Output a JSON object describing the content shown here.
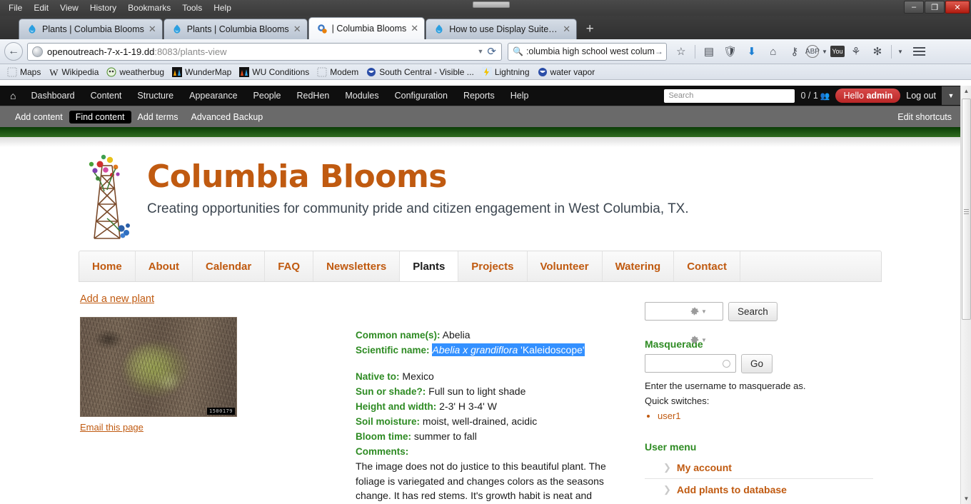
{
  "browser": {
    "menu": [
      "File",
      "Edit",
      "View",
      "History",
      "Bookmarks",
      "Tools",
      "Help"
    ],
    "window_controls": {
      "minimize": "–",
      "maximize": "❐",
      "close": "✕"
    },
    "tabs": [
      {
        "title": "Plants | Columbia Blooms",
        "favicon": "drupal-droplet-icon",
        "active": false
      },
      {
        "title": "Plants | Columbia Blooms",
        "favicon": "drupal-droplet-icon",
        "active": false
      },
      {
        "title": "| Columbia Blooms",
        "favicon": "gear-icon",
        "active": true
      },
      {
        "title": "How to use Display Suite t...",
        "favicon": "drupal-droplet-icon",
        "active": false
      }
    ],
    "new_tab_label": "+",
    "url": {
      "host": "openoutreach-7-x-1-19.dd",
      "rest": ":8083/plants-view"
    },
    "search": {
      "value": ":olumbia high school west colum",
      "placeholder": "Search"
    },
    "toolbar_icons": [
      "star-icon",
      "reader-icon",
      "shield-icon",
      "download-arrow-icon",
      "home-icon",
      "key-icon",
      "abp-icon",
      "youtube-icon",
      "runner-icon",
      "spider-icon",
      "chevron-down-icon",
      "hamburger-menu-icon"
    ],
    "bookmarks": [
      {
        "label": "Maps",
        "icon": "placeholder-icon"
      },
      {
        "label": "Wikipedia",
        "icon": "wikipedia-w-icon"
      },
      {
        "label": "weatherbug",
        "icon": "weatherbug-icon"
      },
      {
        "label": "WunderMap",
        "icon": "wunderground-icon"
      },
      {
        "label": "WU Conditions",
        "icon": "wunderground-icon"
      },
      {
        "label": "Modem",
        "icon": "placeholder-icon"
      },
      {
        "label": "South Central - Visible ...",
        "icon": "noaa-icon"
      },
      {
        "label": "Lightning",
        "icon": "lightning-icon"
      },
      {
        "label": "water vapor",
        "icon": "noaa-icon"
      }
    ]
  },
  "admin_toolbar": {
    "home_icon": "home-icon",
    "items": [
      "Dashboard",
      "Content",
      "Structure",
      "Appearance",
      "People",
      "RedHen",
      "Modules",
      "Configuration",
      "Reports",
      "Help"
    ],
    "search_placeholder": "Search",
    "user_count": "0 / 1",
    "greeting_prefix": "Hello",
    "greeting_user": "admin",
    "logout": "Log out",
    "dropdown_icon": "chevron-down-icon"
  },
  "shortcuts": {
    "items": [
      {
        "label": "Add content",
        "selected": false
      },
      {
        "label": "Find content",
        "selected": true
      },
      {
        "label": "Add terms",
        "selected": false
      },
      {
        "label": "Advanced Backup",
        "selected": false
      }
    ],
    "edit_label": "Edit shortcuts"
  },
  "site": {
    "name": "Columbia Blooms",
    "slogan": "Creating opportunities for community pride and citizen engagement in West Columbia, TX.",
    "logo_icon": "oil-derrick-with-flowers-logo",
    "nav": [
      {
        "label": "Home",
        "active": false
      },
      {
        "label": "About",
        "active": false
      },
      {
        "label": "Calendar",
        "active": false
      },
      {
        "label": "FAQ",
        "active": false
      },
      {
        "label": "Newsletters",
        "active": false
      },
      {
        "label": "Plants",
        "active": true
      },
      {
        "label": "Projects",
        "active": false
      },
      {
        "label": "Volunteer",
        "active": false
      },
      {
        "label": "Watering",
        "active": false
      },
      {
        "label": "Contact",
        "active": false
      }
    ]
  },
  "content": {
    "add_plant_link": "Add a new plant",
    "email_link": "Email this page",
    "image_stamp": "1500179",
    "image_alt": "abelia-shrub-photo",
    "fields": [
      {
        "label": "Common name(s):",
        "value": "Abelia"
      }
    ],
    "scientific": {
      "label": "Scientific name:",
      "italic_part": "Abelia x grandiflora",
      "cultivar_part": "'Kaleidoscope'",
      "selected": true
    },
    "details": [
      {
        "label": "Native to:",
        "value": "Mexico"
      },
      {
        "label": "Sun or shade?:",
        "value": "Full sun to light shade"
      },
      {
        "label": "Height and width:",
        "value": "2-3' H 3-4' W"
      },
      {
        "label": "Soil moisture:",
        "value": "moist, well-drained, acidic"
      },
      {
        "label": "Bloom time:",
        "value": "summer to fall"
      }
    ],
    "comments_label": "Comments:",
    "comments_lines": [
      "The image does not do justice to this beautiful plant. The",
      "foliage is variegated and changes colors as the seasons",
      "change. It has red stems. It's growth habit is neat and"
    ],
    "contextual_gear_icon": "gear-icon"
  },
  "sidebar": {
    "search_button": "Search",
    "search_value": "",
    "masquerade_title": "Masquerade",
    "masquerade_value": "",
    "masquerade_button": "Go",
    "masquerade_help": "Enter the username to masquerade as.",
    "quick_switches_label": "Quick switches:",
    "quick_switches": [
      "user1"
    ],
    "user_menu_title": "User menu",
    "user_menu_items": [
      "My account",
      "Add plants to database"
    ],
    "chevron_icon": "chevron-right-icon"
  },
  "scrollbar": {
    "up_icon": "triangle-up-icon",
    "down_icon": "triangle-down-icon"
  },
  "colors": {
    "brand": "#c05a10",
    "field_label": "#2e8b23",
    "selection": "#3390ff",
    "admin_bar": "#0f0f0f",
    "accent_red": "#b92626"
  }
}
